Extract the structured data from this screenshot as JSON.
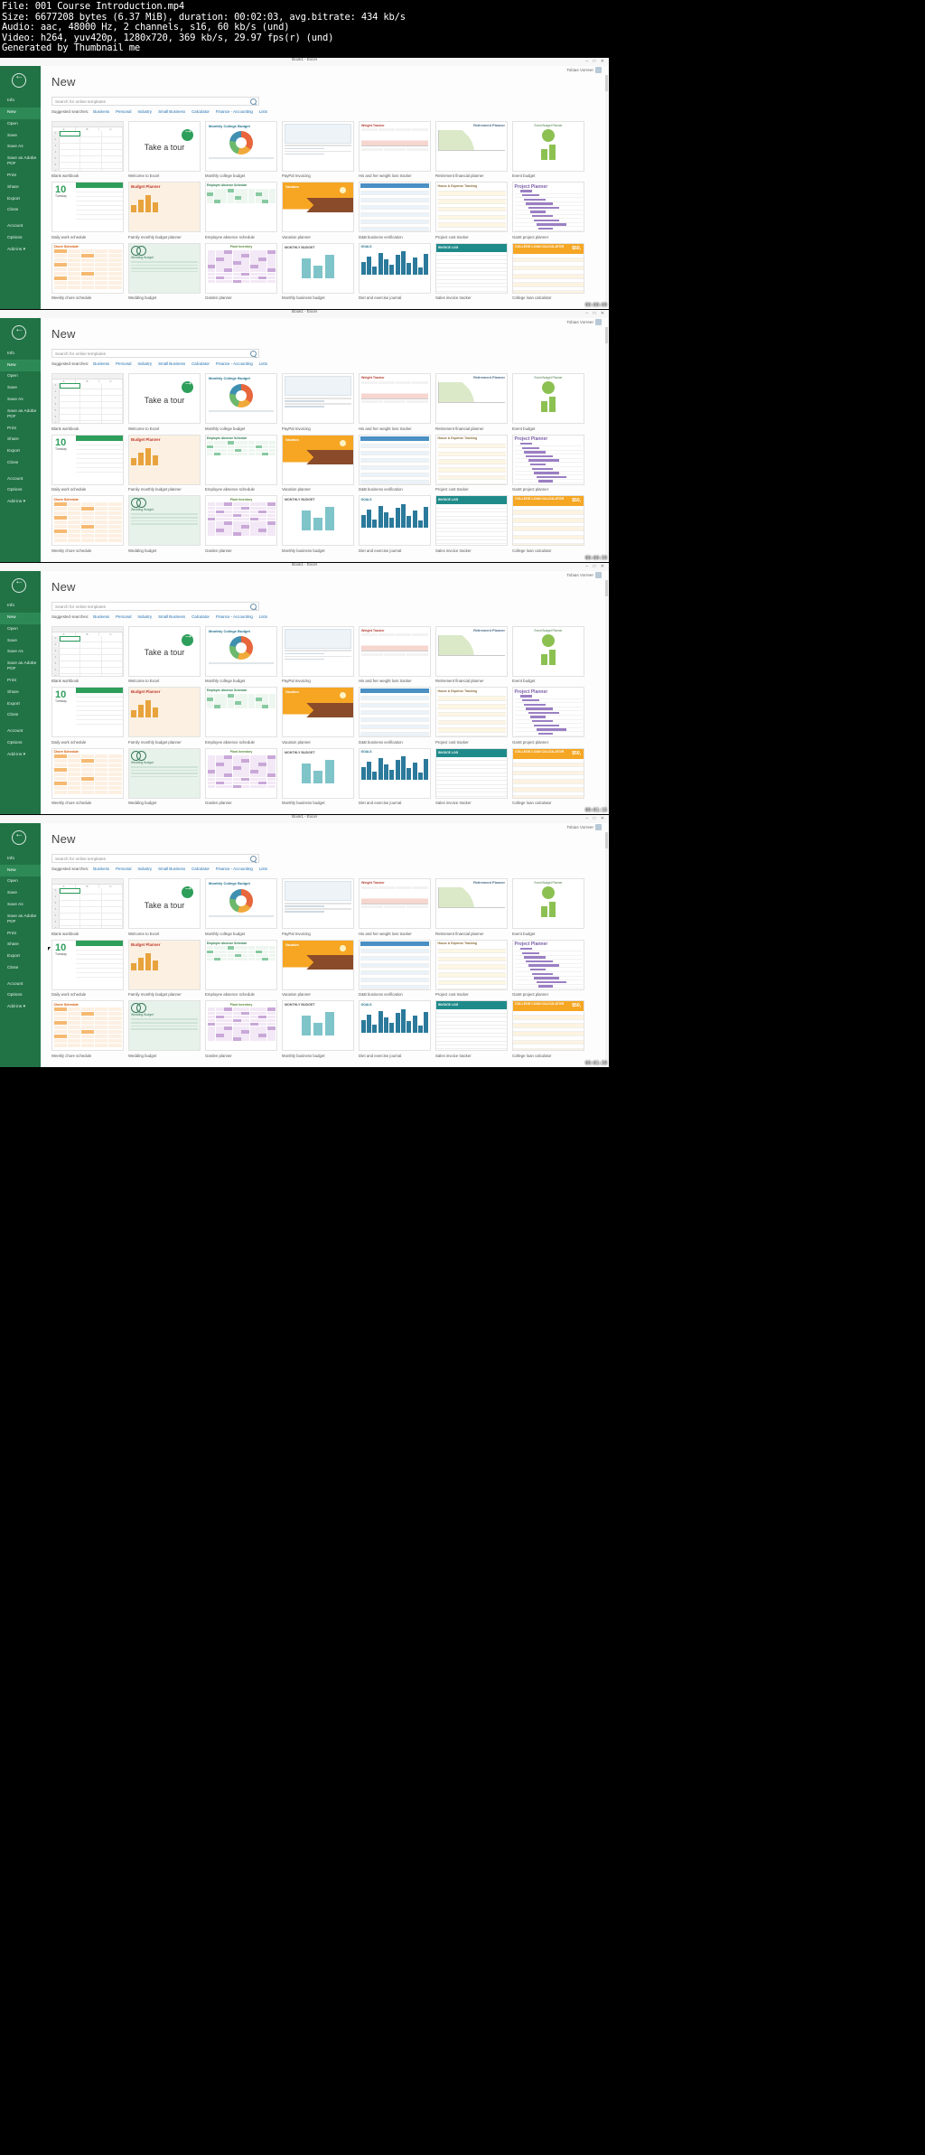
{
  "video_info": {
    "line1": "File: 001 Course Introduction.mp4",
    "line2": "Size: 6677208 bytes (6.37 MiB), duration: 00:02:03, avg.bitrate: 434 kb/s",
    "line3": "Audio: aac, 48000 Hz, 2 channels, s16, 60 kb/s (und)",
    "line4": "Video: h264, yuv420p, 1280x720, 369 kb/s, 29.97 fps(r) (und)",
    "line5": "Generated by Thumbnail me"
  },
  "window": {
    "title": "Book1 - Excel",
    "user": "Tobias Vorreer",
    "minimize": "–",
    "maximize": "□",
    "close": "✕"
  },
  "sidebar": {
    "back_icon": "back-arrow-icon",
    "items": [
      {
        "label": "Info",
        "selected": false
      },
      {
        "label": "New",
        "selected": true
      },
      {
        "label": "Open",
        "selected": false
      },
      {
        "label": "Save",
        "selected": false
      },
      {
        "label": "Save As",
        "selected": false
      },
      {
        "label": "Save as Adobe PDF",
        "selected": false
      },
      {
        "label": "Print",
        "selected": false
      },
      {
        "label": "Share",
        "selected": false
      },
      {
        "label": "Export",
        "selected": false
      },
      {
        "label": "Close",
        "selected": false
      }
    ],
    "items_bottom": [
      {
        "label": "Account"
      },
      {
        "label": "Options"
      },
      {
        "label": "Add-ins ▾"
      }
    ]
  },
  "main": {
    "heading": "New",
    "search_placeholder": "Search for online templates",
    "search_value": "",
    "search_icon": "magnifier-icon",
    "suggested_label": "Suggested searches:",
    "suggested": [
      "Business",
      "Personal",
      "Industry",
      "Small Business",
      "Calculator",
      "Finance - Accounting",
      "Lists"
    ]
  },
  "templates": [
    {
      "caption": "Blank workbook",
      "art": "t-blank"
    },
    {
      "caption": "Welcome to Excel",
      "art": "t-tour",
      "text": "Take a tour"
    },
    {
      "caption": "Monthly college budget",
      "art": "t-donut",
      "title": "Monthly College Budget"
    },
    {
      "caption": "PayPal Invoicing",
      "art": "t-paypal"
    },
    {
      "caption": "His and her weight loss tracker",
      "art": "t-weight",
      "title": "Weight Tracker"
    },
    {
      "caption": "Retirement financial planner",
      "art": "t-retire",
      "title": "Retirement Planner"
    },
    {
      "caption": "Event budget",
      "art": "t-event",
      "title": "Event Budget Planner"
    },
    {
      "caption": "Daily work schedule",
      "art": "t-daily",
      "number": "10",
      "day": "Tuesday"
    },
    {
      "caption": "Family monthly budget planner",
      "art": "t-fam",
      "title": "Budget Planner"
    },
    {
      "caption": "Employee absence schedule",
      "art": "t-emp",
      "title": "Employee Absence Schedule"
    },
    {
      "caption": "Vacation planner",
      "art": "t-vac",
      "title": "Vacation"
    },
    {
      "caption": "D&B business verification",
      "art": "t-dbi"
    },
    {
      "caption": "Project cost tracker",
      "art": "t-proj",
      "title": "House & Expense Tracking"
    },
    {
      "caption": "Gantt project planner",
      "art": "t-gantt",
      "title": "Project Planner"
    },
    {
      "caption": "Weekly chore schedule",
      "art": "t-chore",
      "title": "Chore Schedule"
    },
    {
      "caption": "Wedding budget",
      "art": "t-wed",
      "title": "Wedding Budget"
    },
    {
      "caption": "Garden planner",
      "art": "t-gard",
      "title": "Plant Inventory"
    },
    {
      "caption": "Monthly business budget",
      "art": "t-mbb",
      "title": "MONTHLY BUDGET"
    },
    {
      "caption": "Diet and exercise journal",
      "art": "t-diet",
      "title": "GOALS"
    },
    {
      "caption": "Sales invoice tracker",
      "art": "t-sales",
      "title": "INVOICE LOG"
    },
    {
      "caption": "College loan calculator",
      "art": "t-loan",
      "title": "COLLEGE LOAN CALCULATOR",
      "value": "$50,"
    }
  ],
  "frames": [
    {
      "timestamp": "00:00:09",
      "rows": 3,
      "cursor": false
    },
    {
      "timestamp": "00:00:59",
      "rows": 3,
      "cursor": false
    },
    {
      "timestamp": "00:01:15",
      "rows": 3,
      "cursor": false
    },
    {
      "timestamp": "00:01:39",
      "rows": 3,
      "cursor": true
    }
  ],
  "colors": {
    "excel_green": "#217346",
    "excel_green_selected": "#2d8a57",
    "accent_link": "#1f6fb2"
  }
}
